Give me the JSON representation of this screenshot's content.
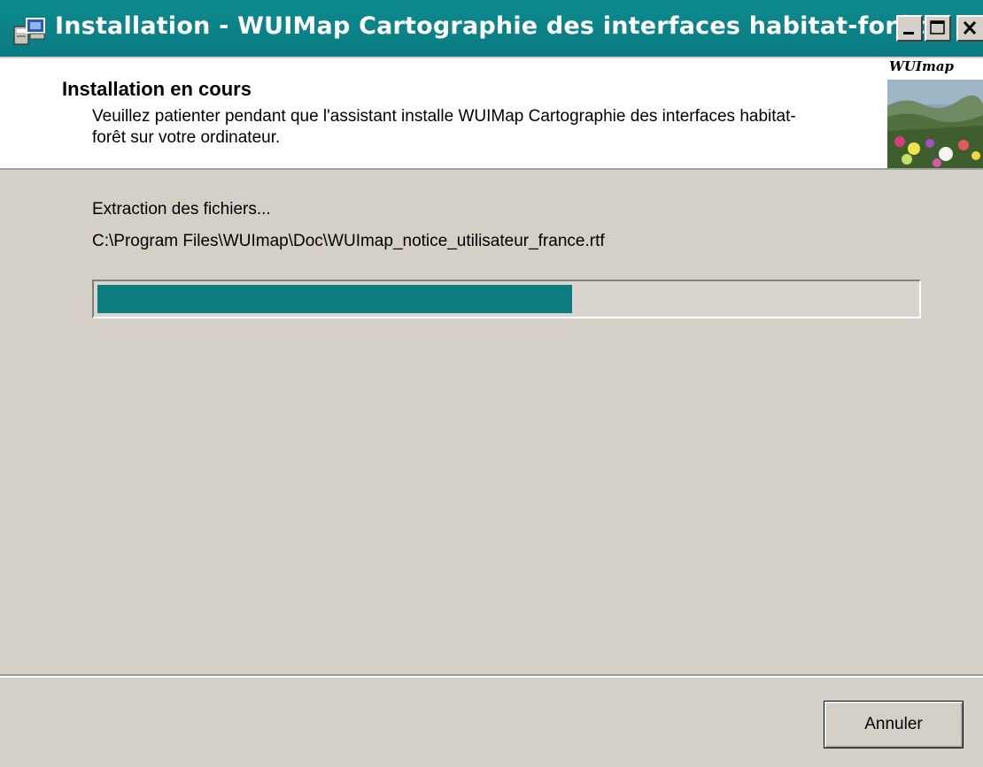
{
  "window": {
    "title": "Installation - WUIMap Cartographie des interfaces habitat-forêt",
    "icon": "installer-icon",
    "controls": [
      "minimize-icon",
      "maximize-icon",
      "close-icon"
    ]
  },
  "header": {
    "title": "Installation en cours",
    "subtitle": "Veuillez patienter pendant que l'assistant installe WUIMap Cartographie des interfaces habitat-forêt sur votre ordinateur.",
    "logo_text": "WUImap"
  },
  "status": {
    "label": "Extraction des fichiers...",
    "path": "C:\\Program Files\\WUImap\\Doc\\WUImap_notice_utilisateur_france.rtf",
    "progress": 0.58
  },
  "footer": {
    "cancel_label": "Annuler"
  },
  "colors": {
    "titlebar": "#0e8b8f",
    "progress_fill": "#0d7c7e",
    "dialog_face": "#d4d0c8"
  }
}
